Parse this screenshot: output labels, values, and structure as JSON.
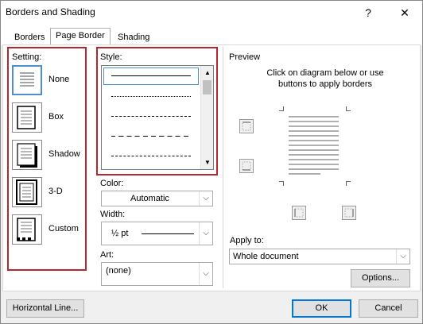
{
  "window": {
    "title": "Borders and Shading",
    "help_glyph": "?",
    "close_glyph": "✕"
  },
  "tabs": [
    {
      "label": "Borders",
      "active": false
    },
    {
      "label": "Page Border",
      "active": true
    },
    {
      "label": "Shading",
      "active": false
    }
  ],
  "setting": {
    "label": "Setting:",
    "items": [
      {
        "label": "None",
        "icon": "none-setting-icon",
        "selected": true
      },
      {
        "label": "Box",
        "icon": "box-setting-icon",
        "selected": false
      },
      {
        "label": "Shadow",
        "icon": "shadow-setting-icon",
        "selected": false
      },
      {
        "label": "3-D",
        "icon": "3d-setting-icon",
        "selected": false
      },
      {
        "label": "Custom",
        "icon": "custom-setting-icon",
        "selected": false
      }
    ]
  },
  "style": {
    "label": "Style:"
  },
  "color": {
    "label": "Color:",
    "value": "Automatic"
  },
  "width": {
    "label": "Width:",
    "value": "½ pt"
  },
  "art": {
    "label": "Art:",
    "value": "(none)"
  },
  "preview": {
    "label": "Preview",
    "hint": "Click on diagram below or use buttons to apply borders"
  },
  "apply_to": {
    "label": "Apply to:",
    "value": "Whole document"
  },
  "buttons": {
    "options": "Options...",
    "horizontal_line": "Horizontal Line...",
    "ok": "OK",
    "cancel": "Cancel"
  },
  "colors": {
    "highlight": "#b5262f",
    "accent": "#0078d7"
  }
}
